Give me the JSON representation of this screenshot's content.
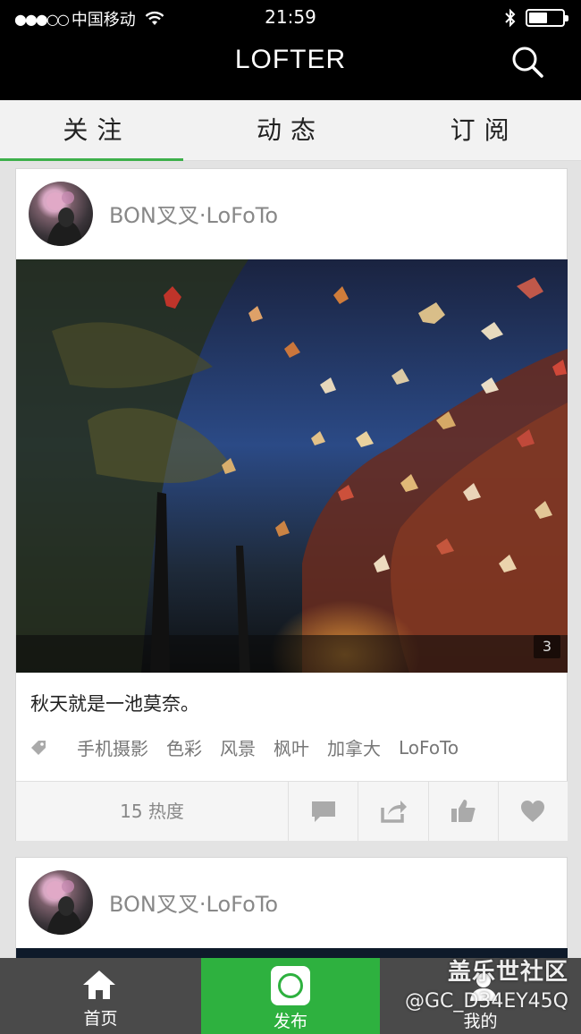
{
  "status_bar": {
    "signal": "●●●○○",
    "carrier": "中国移动",
    "time": "21:59",
    "battery_level": 0.55
  },
  "nav": {
    "title": "LOFTER"
  },
  "tabs": [
    {
      "label": "关注",
      "active": true
    },
    {
      "label": "动态",
      "active": false
    },
    {
      "label": "订阅",
      "active": false
    }
  ],
  "posts": [
    {
      "author": "BON叉叉·LoFoTo",
      "image_count": "3",
      "caption": "秋天就是一池莫奈。",
      "tags": [
        "手机摄影",
        "色彩",
        "风景",
        "枫叶",
        "加拿大",
        "LoFoTo"
      ],
      "heat": "15 热度"
    },
    {
      "author": "BON叉叉·LoFoTo"
    }
  ],
  "tab_bar": {
    "home": "首页",
    "publish": "发布",
    "mine": "我的"
  },
  "watermark": {
    "line1": "盖乐世社区",
    "line2": "@GC_D34EY45Q"
  },
  "colors": {
    "accent_green": "#2eb13f",
    "tab_underline": "#3db04b",
    "nav_bg": "#000000"
  }
}
